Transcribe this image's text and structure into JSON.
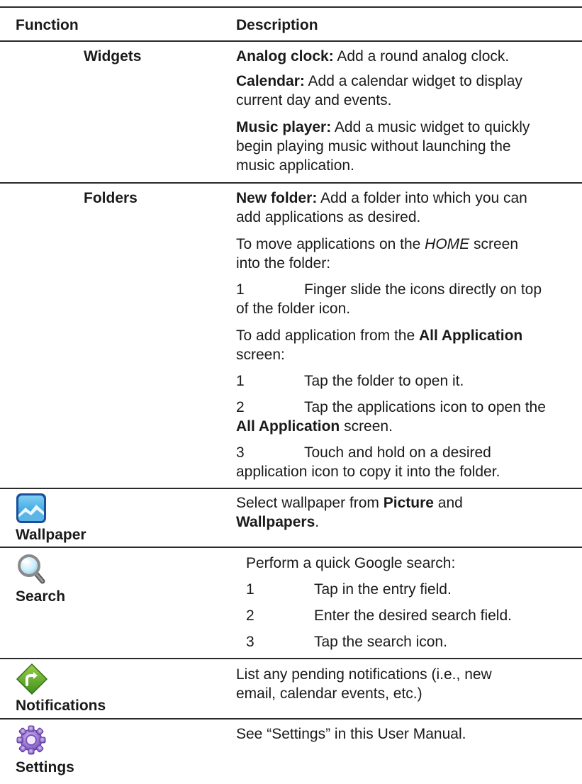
{
  "header": {
    "function": "Function",
    "description": "Description"
  },
  "widgets": {
    "function": "Widgets",
    "analog_label": "Analog clock:",
    "analog_text": " Add a round analog clock.",
    "calendar_label": "Calendar:",
    "calendar_line1": " Add a calendar widget to display",
    "calendar_line2": "current day and events.",
    "music_label": "Music player:",
    "music_line1": "  Add a music widget to quickly",
    "music_line2": "begin playing music without launching the",
    "music_line3": "music application."
  },
  "folders": {
    "function": "Folders",
    "newfolder_label": "New folder:",
    "newfolder_line1": " Add a folder into which you can",
    "newfolder_line2": "add applications as desired.",
    "move_line1_a": "To move applications on the ",
    "move_line1_home": "HOME",
    "move_line1_b": " screen",
    "move_line2": "into the folder:",
    "step_a1_num": "1",
    "step_a1_line1": "Finger slide the icons directly on top",
    "step_a1_line2": "of the folder icon.",
    "add_line1_a": "To add application from the ",
    "add_line1_bold": "All Application",
    "add_line2": "screen:",
    "step_b1_num": "1",
    "step_b1_text": "Tap the folder to open it.",
    "step_b2_num": "2",
    "step_b2_line1": "Tap the applications icon to open the",
    "step_b2_line2_bold": "All Application",
    "step_b2_line2_rest": " screen.",
    "step_b3_num": "3",
    "step_b3_line1": "Touch and hold on a desired",
    "step_b3_line2": "application icon to copy it into the folder."
  },
  "wallpaper": {
    "function": "Wallpaper",
    "icon": "wallpaper-icon",
    "line1_a": "Select wallpaper from ",
    "line1_bold": "Picture",
    "line1_b": " and",
    "line2_bold": "Wallpapers",
    "line2_b": "."
  },
  "search": {
    "function": "Search",
    "icon": "magnifier-icon",
    "intro": "Perform a quick Google search:",
    "steps": [
      {
        "num": "1",
        "text": "Tap in the entry field."
      },
      {
        "num": "2",
        "text": "Enter the desired search field."
      },
      {
        "num": "3",
        "text": "Tap the search icon."
      }
    ]
  },
  "notifications": {
    "function": "Notifications",
    "icon": "notification-arrow-icon",
    "line1": "List any pending notifications (i.e., new",
    "line2": "email, calendar events, etc.)"
  },
  "settings": {
    "function": "Settings",
    "icon": "gear-icon",
    "line1": "See “Settings” in this User Manual."
  }
}
